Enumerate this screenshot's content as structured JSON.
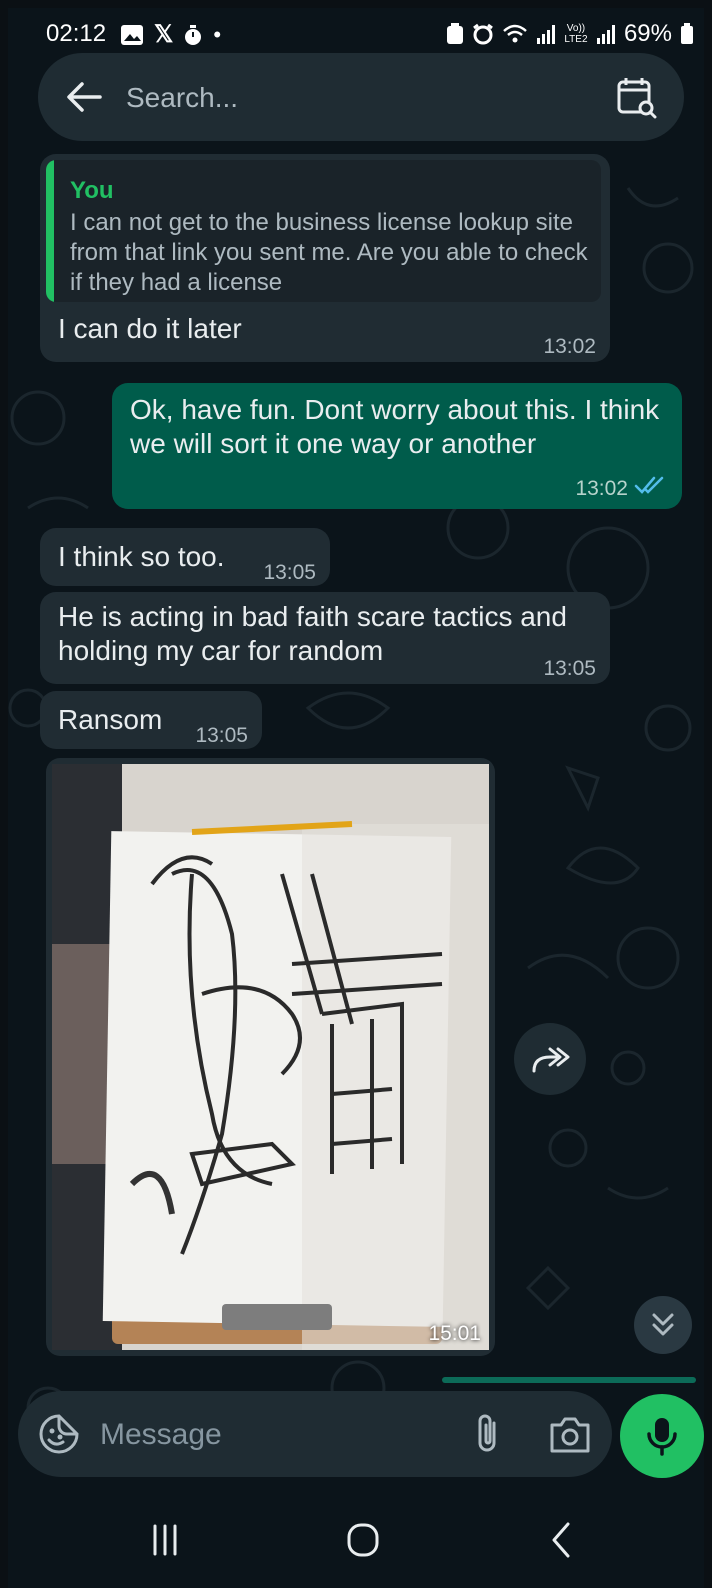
{
  "status_bar": {
    "time": "02:12",
    "battery": "69%",
    "network_label": "Vo)) LTE2"
  },
  "search": {
    "placeholder": "Search..."
  },
  "messages": [
    {
      "direction": "incoming",
      "reply_to": {
        "author": "You",
        "text": "I can not get to the business license lookup site from that link you sent me. Are you able to check if they had a license"
      },
      "text": "I can do it later",
      "time": "13:02"
    },
    {
      "direction": "outgoing",
      "text": "Ok, have fun. Dont worry about this. I think we will sort it one way or another",
      "time": "13:02",
      "status": "read"
    },
    {
      "direction": "incoming",
      "text": "I think so too.",
      "time": "13:05"
    },
    {
      "direction": "incoming",
      "text": "He is acting in bad faith scare tactics and holding my car for random",
      "time": "13:05"
    },
    {
      "direction": "incoming",
      "text": "Ransom",
      "time": "13:05"
    },
    {
      "direction": "incoming",
      "type": "image",
      "time": "15:01"
    }
  ],
  "composer": {
    "placeholder": "Message"
  },
  "colors": {
    "background": "#0b141a",
    "incoming_bubble": "#202c33",
    "outgoing_bubble": "#005c4b",
    "accent": "#21c063",
    "read_ticks": "#53bdeb"
  },
  "icons": {
    "back": "arrow-left-icon",
    "calendar": "calendar-search-icon",
    "forward": "forward-icon",
    "scroll": "double-chevron-down-icon",
    "sticker": "sticker-icon",
    "attach": "paperclip-icon",
    "camera": "camera-icon",
    "mic": "microphone-icon"
  }
}
